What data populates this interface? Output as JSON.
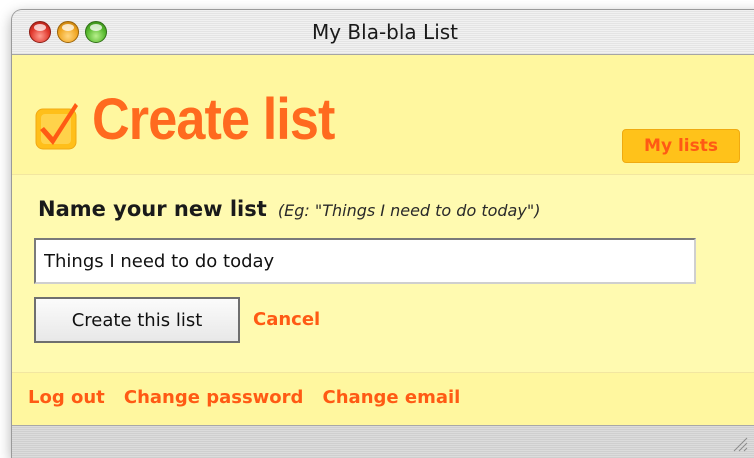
{
  "window": {
    "title": "My Bla-bla List"
  },
  "header": {
    "title": "Create list",
    "logo_icon": "checkbox-check-icon",
    "my_lists_label": "My lists"
  },
  "form": {
    "label": "Name your new list",
    "hint": "(Eg: \"Things I need to do today\")",
    "input_value": "Things I need to do today",
    "submit_label": "Create this list",
    "cancel_label": "Cancel"
  },
  "footer": {
    "links": [
      "Log out",
      "Change password",
      "Change email"
    ]
  },
  "colors": {
    "accent": "#ff6a1f",
    "link": "#ff5a14",
    "background": "#fffab0",
    "header_bg": "#fff79f",
    "button_yellow": "#ffc21a"
  }
}
